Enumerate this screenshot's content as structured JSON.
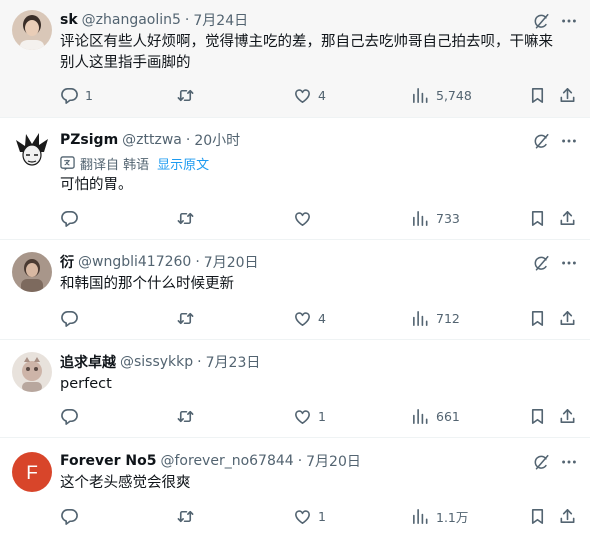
{
  "tweets": [
    {
      "name": "sk",
      "handle": "@zhangaolin5",
      "time": "7月24日",
      "text_lines": [
        "评论区有些人好烦啊，觉得博主吃的差，那自己去吃帅哥自己拍去呗，干嘛来",
        "别人这里指手画脚的"
      ],
      "replies": "1",
      "retweets": "",
      "likes": "4",
      "views": "5,748",
      "avatar_color": "#d9c7b8"
    },
    {
      "name": "PZsigm",
      "handle": "@zttzwa",
      "time": "20小时",
      "translate_label": "翻译自 韩语",
      "translate_action": "显示原文",
      "text_lines": [
        "可怕的胃。"
      ],
      "replies": "",
      "retweets": "",
      "likes": "",
      "views": "733",
      "avatar_color": "#ffffff"
    },
    {
      "name": "衍",
      "handle": "@wngbli417260",
      "time": "7月20日",
      "text_lines": [
        "和韩国的那个什么时候更新"
      ],
      "replies": "",
      "retweets": "",
      "likes": "4",
      "views": "712",
      "avatar_color": "#a8968a"
    },
    {
      "name": "追求卓越",
      "handle": "@sissykkp",
      "time": "7月23日",
      "text_lines": [
        "perfect"
      ],
      "replies": "",
      "retweets": "",
      "likes": "1",
      "views": "661",
      "avatar_color": "#e8e2dc"
    },
    {
      "name": "Forever No5",
      "handle": "@forever_no67844",
      "time": "7月20日",
      "text_lines": [
        "这个老头感觉会很爽"
      ],
      "replies": "",
      "retweets": "",
      "likes": "1",
      "views": "1.1万",
      "avatar_letter": "F",
      "avatar_color": "#d8452a"
    }
  ],
  "header_separator": "·",
  "icons": {
    "reply": "reply-icon",
    "retweet": "retweet-icon",
    "like": "heart-icon",
    "views": "views-bar-icon",
    "bookmark": "bookmark-icon",
    "share": "share-icon",
    "grok": "grok-icon",
    "more": "more-icon",
    "translate": "translate-icon"
  },
  "colors": {
    "text": "#0f1419",
    "secondary": "#536471",
    "link": "#1d9bf0",
    "highlight_bg": "#f7f7f7"
  }
}
